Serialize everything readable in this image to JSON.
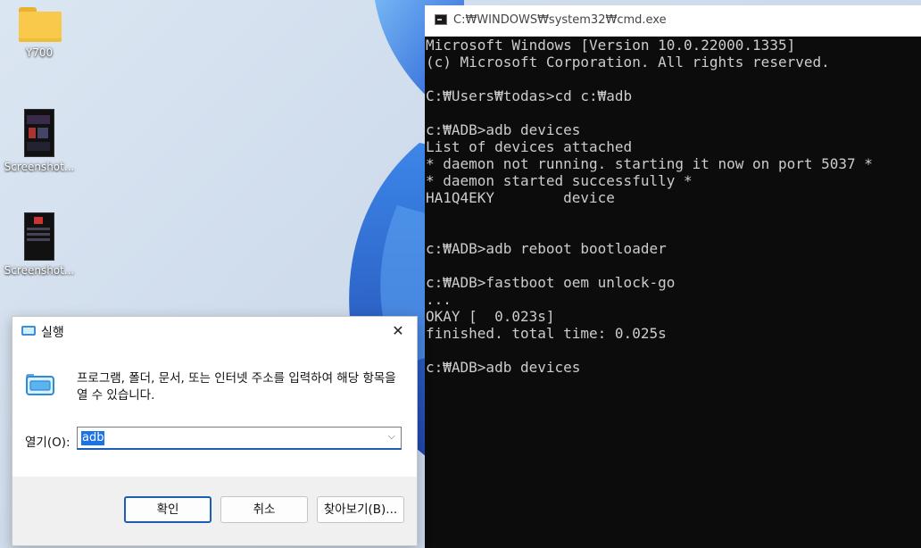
{
  "desktop": {
    "icons": [
      {
        "label": "Y700",
        "kind": "folder-icon"
      },
      {
        "label": "Screenshot...",
        "kind": "image-file-icon"
      },
      {
        "label": "Screenshot...",
        "kind": "image-file-icon"
      }
    ]
  },
  "cmd": {
    "title": "C:₩WINDOWS₩system32₩cmd.exe",
    "lines": [
      "Microsoft Windows [Version 10.0.22000.1335]",
      "(c) Microsoft Corporation. All rights reserved.",
      "",
      "C:₩Users₩todas>cd c:₩adb",
      "",
      "c:₩ADB>adb devices",
      "List of devices attached",
      "* daemon not running. starting it now on port 5037 *",
      "* daemon started successfully *",
      "HA1Q4EKY        device",
      "",
      "",
      "c:₩ADB>adb reboot bootloader",
      "",
      "c:₩ADB>fastboot oem unlock-go",
      "...",
      "OKAY [  0.023s]",
      "finished. total time: 0.025s",
      "",
      "c:₩ADB>adb devices"
    ]
  },
  "run_dialog": {
    "title": "실행",
    "close_glyph": "✕",
    "description": "프로그램, 폴더, 문서, 또는 인터넷 주소를 입력하여 해당 항목을 열 수 있습니다.",
    "open_label": "열기(O):",
    "open_value": "adb",
    "dropdown_glyph": "⌵",
    "buttons": {
      "ok": "확인",
      "cancel": "취소",
      "browse": "찾아보기(B)..."
    }
  },
  "colors": {
    "cmd_bg": "#0c0c0c",
    "cmd_text": "#cccccc",
    "accent": "#1a5fb4",
    "selection": "#1a73e8"
  }
}
